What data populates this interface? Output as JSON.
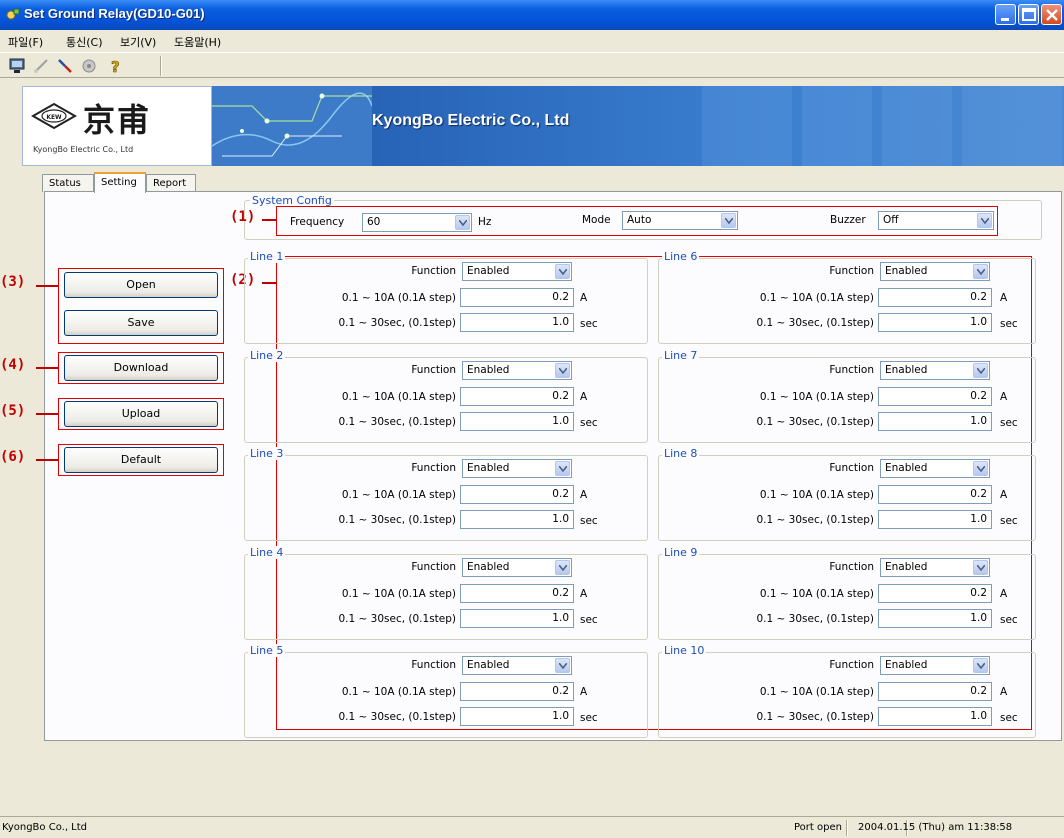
{
  "window": {
    "title": "Set Ground Relay(GD10-G01)",
    "title_icon": "relay-app-icon"
  },
  "menu": [
    "파일(F)",
    "통신(C)",
    "보기(V)",
    "도움말(H)"
  ],
  "toolbar": {
    "icons": [
      "computer-icon",
      "connect-icon",
      "disconnect-icon",
      "settings-icon",
      "help-icon"
    ]
  },
  "banner": {
    "logo_main": "京甫",
    "logo_emblem": "KEW",
    "logo_sub": "KyongBo Electric Co., Ltd",
    "title": "KyongBo Electric Co., Ltd"
  },
  "tabs": [
    {
      "label": "Status",
      "active": false
    },
    {
      "label": "Setting",
      "active": true
    },
    {
      "label": "Report",
      "active": false
    }
  ],
  "system_config": {
    "legend": "System Config",
    "frequency_label": "Frequency",
    "frequency_value": "60",
    "frequency_unit": "Hz",
    "mode_label": "Mode",
    "mode_value": "Auto",
    "buzzer_label": "Buzzer",
    "buzzer_value": "Off"
  },
  "markers": [
    "(1)",
    "(2)",
    "(3)",
    "(4)",
    "(5)",
    "(6)"
  ],
  "buttons": {
    "open": "Open",
    "save": "Save",
    "download": "Download",
    "upload": "Upload",
    "default": "Default"
  },
  "lines": [
    {
      "name": "Line 1",
      "function_label": "Function",
      "function_value": "Enabled",
      "current_label": "0.1 ~ 10A (0.1A step)",
      "current_value": "0.2",
      "current_unit": "A",
      "time_label": "0.1 ~ 30sec, (0.1step)",
      "time_value": "1.0",
      "time_unit": "sec"
    },
    {
      "name": "Line 2",
      "function_label": "Function",
      "function_value": "Enabled",
      "current_label": "0.1 ~ 10A (0.1A step)",
      "current_value": "0.2",
      "current_unit": "A",
      "time_label": "0.1 ~ 30sec, (0.1step)",
      "time_value": "1.0",
      "time_unit": "sec"
    },
    {
      "name": "Line 3",
      "function_label": "Function",
      "function_value": "Enabled",
      "current_label": "0.1 ~ 10A (0.1A step)",
      "current_value": "0.2",
      "current_unit": "A",
      "time_label": "0.1 ~ 30sec, (0.1step)",
      "time_value": "1.0",
      "time_unit": "sec"
    },
    {
      "name": "Line 4",
      "function_label": "Function",
      "function_value": "Enabled",
      "current_label": "0.1 ~ 10A (0.1A step)",
      "current_value": "0.2",
      "current_unit": "A",
      "time_label": "0.1 ~ 30sec, (0.1step)",
      "time_value": "1.0",
      "time_unit": "sec"
    },
    {
      "name": "Line 5",
      "function_label": "Function",
      "function_value": "Enabled",
      "current_label": "0.1 ~ 10A (0.1A step)",
      "current_value": "0.2",
      "current_unit": "A",
      "time_label": "0.1 ~ 30sec, (0.1step)",
      "time_value": "1.0",
      "time_unit": "sec"
    },
    {
      "name": "Line 6",
      "function_label": "Function",
      "function_value": "Enabled",
      "current_label": "0.1 ~ 10A (0.1A step)",
      "current_value": "0.2",
      "current_unit": "A",
      "time_label": "0.1 ~ 30sec, (0.1step)",
      "time_value": "1.0",
      "time_unit": "sec"
    },
    {
      "name": "Line 7",
      "function_label": "Function",
      "function_value": "Enabled",
      "current_label": "0.1 ~ 10A (0.1A step)",
      "current_value": "0.2",
      "current_unit": "A",
      "time_label": "0.1 ~ 30sec, (0.1step)",
      "time_value": "1.0",
      "time_unit": "sec"
    },
    {
      "name": "Line 8",
      "function_label": "Function",
      "function_value": "Enabled",
      "current_label": "0.1 ~ 10A (0.1A step)",
      "current_value": "0.2",
      "current_unit": "A",
      "time_label": "0.1 ~ 30sec, (0.1step)",
      "time_value": "1.0",
      "time_unit": "sec"
    },
    {
      "name": "Line 9",
      "function_label": "Function",
      "function_value": "Enabled",
      "current_label": "0.1 ~ 10A (0.1A step)",
      "current_value": "0.2",
      "current_unit": "A",
      "time_label": "0.1 ~ 30sec, (0.1step)",
      "time_value": "1.0",
      "time_unit": "sec"
    },
    {
      "name": "Line 10",
      "function_label": "Function",
      "function_value": "Enabled",
      "current_label": "0.1 ~ 10A (0.1A step)",
      "current_value": "0.2",
      "current_unit": "A",
      "time_label": "0.1 ~ 30sec, (0.1step)",
      "time_value": "1.0",
      "time_unit": "sec"
    }
  ],
  "statusbar": {
    "left": "KyongBo Co., Ltd",
    "port": "Port open",
    "datetime": "2004.01.15 (Thu) am 11:38:58"
  },
  "colors": {
    "titlebar": "#0553d8",
    "annotation_red": "#e00000",
    "legend_blue": "#1e4fb5"
  }
}
